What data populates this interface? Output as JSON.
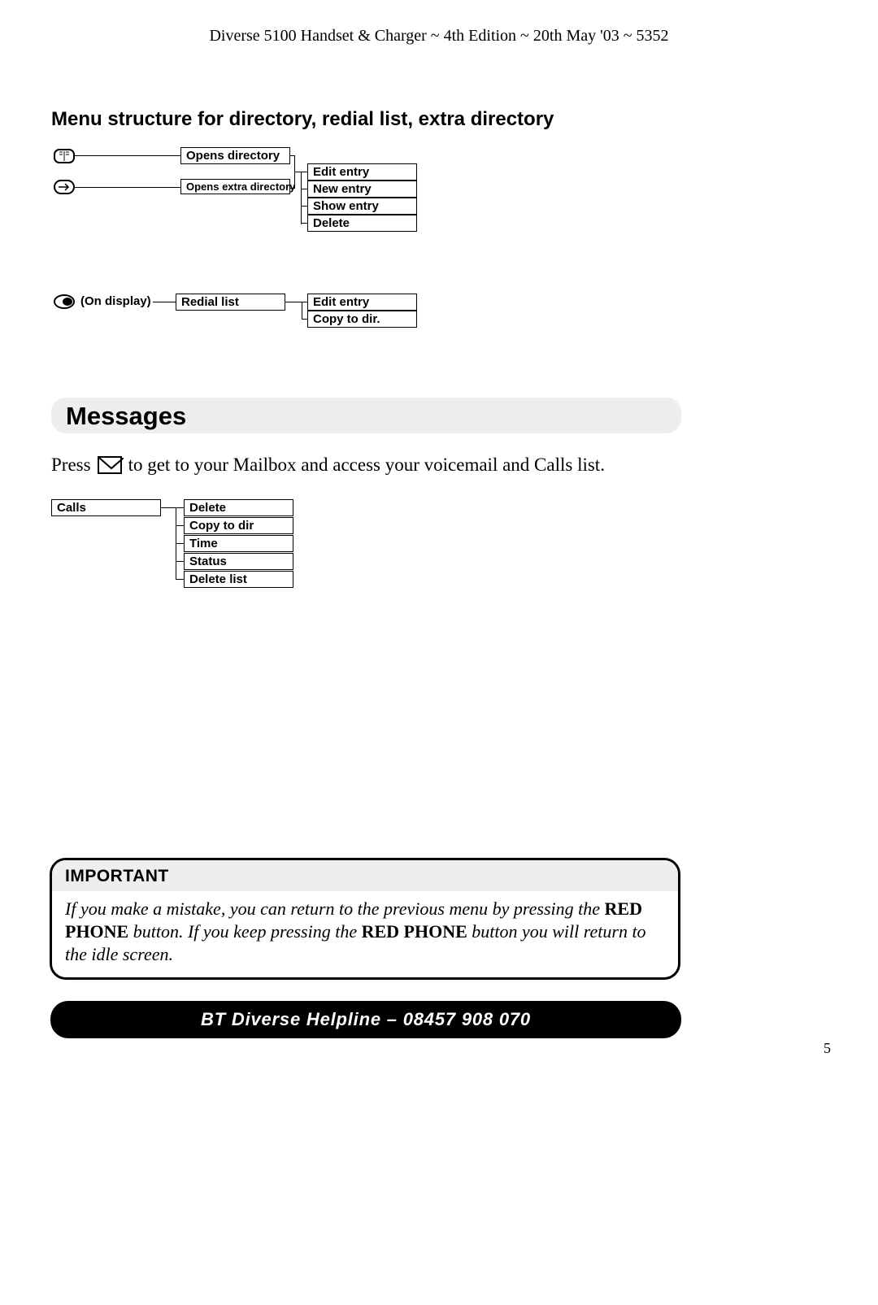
{
  "header": "Diverse 5100 Handset & Charger ~ 4th Edition ~ 20th May '03 ~ 5352",
  "section_title": "Menu structure for directory, redial list, extra directory",
  "diagram1": {
    "opens_directory": "Opens directory",
    "opens_extra": "Opens extra directory",
    "sub": {
      "edit": "Edit entry",
      "new": "New entry",
      "show": "Show entry",
      "delete": "Delete"
    }
  },
  "diagram2": {
    "on_display": "(On display)",
    "redial": "Redial list",
    "sub": {
      "edit": "Edit entry",
      "copy": "Copy to dir."
    }
  },
  "messages": {
    "heading": "Messages",
    "press_before": "Press",
    "press_after": "to get to your Mailbox and access your voicemail and Calls list."
  },
  "diagram3": {
    "calls": "Calls",
    "sub": {
      "delete": "Delete",
      "copy": "Copy to dir",
      "time": "Time",
      "status": "Status",
      "delete_list": "Delete list"
    }
  },
  "important": {
    "title": "IMPORTANT",
    "p1a": "If you make a mistake, you can return to the previous menu by pressing the ",
    "b1": "RED PHONE",
    "p1b": " button. If you keep pressing the ",
    "b2": "RED PHONE",
    "p1c": " button you will return to the idle screen."
  },
  "helpline": "BT Diverse Helpline – 08457 908 070",
  "page_number": "5"
}
